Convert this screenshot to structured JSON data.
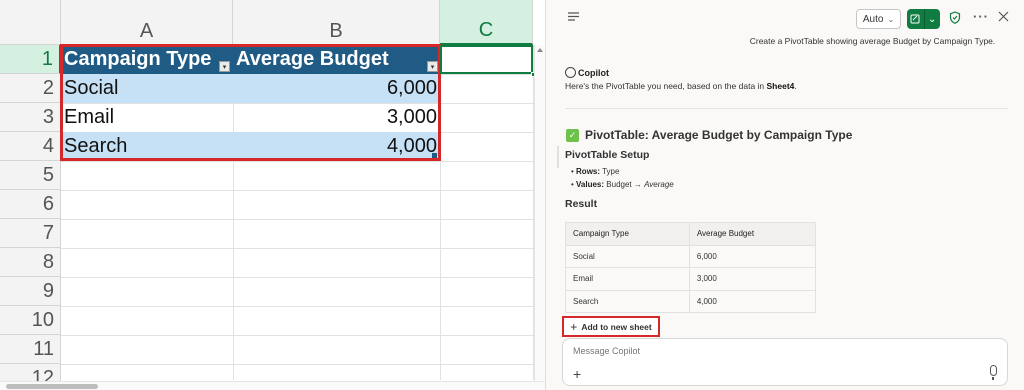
{
  "spreadsheet": {
    "columns": [
      "A",
      "B",
      "C"
    ],
    "rows": [
      "1",
      "2",
      "3",
      "4",
      "5",
      "6",
      "7",
      "8",
      "9",
      "10",
      "11",
      "12"
    ],
    "table": {
      "headers": [
        "Campaign Type",
        "Average Budget"
      ],
      "data": [
        [
          "Social",
          "6,000"
        ],
        [
          "Email",
          "3,000"
        ],
        [
          "Search",
          "4,000"
        ]
      ]
    },
    "colors": {
      "header_fill": "#1f5b85",
      "band_fill": "#c6e0f5",
      "highlight_red": "#d62828",
      "selection_green": "#107c41"
    }
  },
  "copilot": {
    "toolbar": {
      "auto_label": "Auto"
    },
    "user_message": "Create a PivotTable showing average Budget by Campaign Type.",
    "assistant_name": "Copilot",
    "reply": {
      "prefix": "Here's the PivotTable you need, based on the data in ",
      "sheet": "Sheet4",
      "suffix": "."
    },
    "result_title": "PivotTable: Average Budget by Campaign Type",
    "setup": {
      "heading": "PivotTable Setup",
      "rows_label": "Rows:",
      "rows_value": "Type",
      "values_label": "Values:",
      "values_value": "Budget → ",
      "values_agg": "Average"
    },
    "result_heading": "Result",
    "result_table": {
      "headers": [
        "Campaign Type",
        "Average Budget"
      ],
      "rows": [
        [
          "Social",
          "6,000"
        ],
        [
          "Email",
          "3,000"
        ],
        [
          "Search",
          "4,000"
        ]
      ]
    },
    "add_button": "Add to new sheet",
    "message_placeholder": "Message Copilot"
  }
}
